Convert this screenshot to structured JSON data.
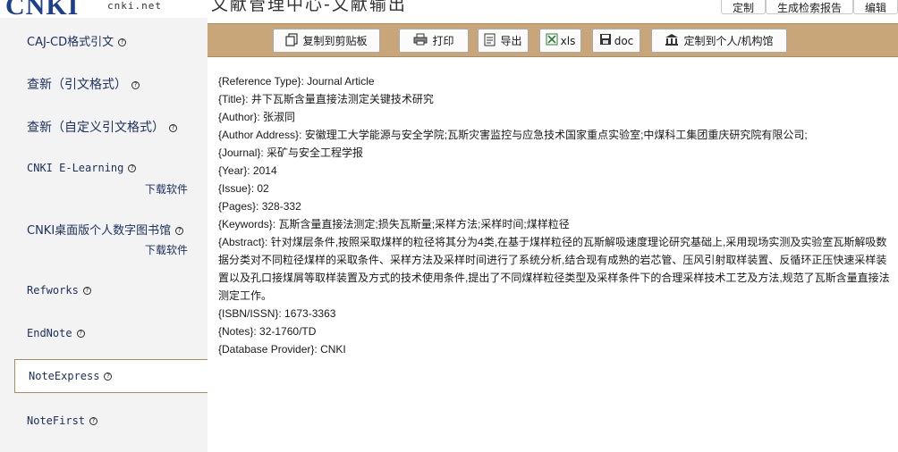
{
  "header": {
    "logo_mark": "CNKI",
    "logo_text": "cnki.net",
    "title": "文献管理中心-文献输出",
    "tabs": [
      "定制",
      "生成检索报告",
      "编辑"
    ]
  },
  "sidebar": {
    "items": [
      {
        "label": "CAJ-CD格式引文",
        "has_help": true
      },
      {
        "label": "查新（引文格式）",
        "has_help": true
      },
      {
        "label": "查新（自定义引文格式）",
        "has_help": true
      },
      {
        "label": "CNKI E-Learning",
        "has_help": true,
        "download": "下载软件"
      },
      {
        "label": "CNKI桌面版个人数字图书馆",
        "has_help": true,
        "download": "下载软件"
      },
      {
        "label": "Refworks",
        "has_help": true
      },
      {
        "label": "EndNote",
        "has_help": true
      },
      {
        "label": "NoteExpress",
        "has_help": true,
        "active": true
      },
      {
        "label": "NoteFirst",
        "has_help": true
      }
    ],
    "help_glyph": "?"
  },
  "toolbar": {
    "buttons": [
      {
        "label": "复制到剪贴板",
        "icon": "copy-icon"
      },
      {
        "label": "打印",
        "icon": "print-icon"
      },
      {
        "label": "导出",
        "icon": "export-icon"
      },
      {
        "label": "xls",
        "icon": "excel-icon"
      },
      {
        "label": "doc",
        "icon": "save-disk-icon"
      },
      {
        "label": "定制到个人/机构馆",
        "icon": "library-icon"
      }
    ]
  },
  "reference": {
    "lines": [
      "{Reference Type}: Journal Article",
      "{Title}: 井下瓦斯含量直接法测定关键技术研究",
      "{Author}: 张淑同",
      "{Author Address}: 安徽理工大学能源与安全学院;瓦斯灾害监控与应急技术国家重点实验室;中煤科工集团重庆研究院有限公司;",
      "{Journal}: 采矿与安全工程学报",
      "{Year}: 2014",
      "{Issue}: 02",
      "{Pages}: 328-332",
      "{Keywords}: 瓦斯含量直接法测定;损失瓦斯量;采样方法;采样时间;煤样粒径"
    ],
    "abstract": "{Abstract}: 针对煤层条件,按照采取煤样的粒径将其分为4类,在基于煤样粒径的瓦斯解吸速度理论研究基础上,采用现场实测及实验室瓦斯解吸数据分类对不同粒径煤样的采取条件、采样方法及采样时间进行了系统分析,结合现有成熟的岩芯管、压风引射取样装置、反循环正压快速采样装置以及孔口接煤屑等取样装置及方式的技术使用条件,提出了不同煤样粒径类型及采样条件下的合理采样技术工艺及方法,规范了瓦斯含量直接法测定工作。",
    "tail_lines": [
      "{ISBN/ISSN}: 1673-3363",
      "{Notes}: 32-1760/TD",
      "{Database Provider}: CNKI"
    ]
  },
  "colors": {
    "toolbar_bg": "#c9a57a",
    "sidebar_bg": "#f3f3f3",
    "link": "#1a2f5c"
  }
}
